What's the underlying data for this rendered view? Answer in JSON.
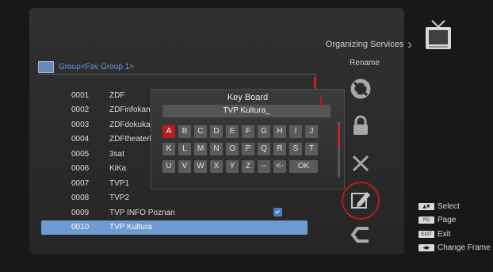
{
  "group": {
    "label": "Group<Fav Group 1>"
  },
  "channels": [
    {
      "num": "0001",
      "name": "ZDF"
    },
    {
      "num": "0002",
      "name": "ZDFinfokanal"
    },
    {
      "num": "0003",
      "name": "ZDFdokukanal"
    },
    {
      "num": "0004",
      "name": "ZDFtheaterkan"
    },
    {
      "num": "0005",
      "name": "3sat"
    },
    {
      "num": "0006",
      "name": "KiKa"
    },
    {
      "num": "0007",
      "name": "TVP1"
    },
    {
      "num": "0008",
      "name": "TVP2"
    },
    {
      "num": "0009",
      "name": "TVP INFO Poznan"
    },
    {
      "num": "0010",
      "name": "TVP Kultura"
    }
  ],
  "keyboard": {
    "title": "Key Board",
    "input_value": "TVP Kultura_",
    "row1": [
      "A",
      "B",
      "C",
      "D",
      "E",
      "F",
      "G",
      "H",
      "I",
      "J"
    ],
    "row2": [
      "K",
      "L",
      "M",
      "N",
      "O",
      "P",
      "Q",
      "R",
      "S",
      "T"
    ],
    "row3": [
      "U",
      "V",
      "W",
      "X",
      "Y",
      "Z",
      "--",
      "<-",
      "OK"
    ]
  },
  "menu": {
    "title": "Organizing Services",
    "subtitle": "Rename"
  },
  "legend": [
    {
      "key": "▲▼",
      "label": "Select"
    },
    {
      "key": "PG",
      "label": "Page"
    },
    {
      "key": "EXIT",
      "label": "Exit"
    },
    {
      "key": "◀▶",
      "label": "Change Frame"
    }
  ],
  "colors": {
    "accent_red": "#b31f1f",
    "selection_blue": "#6e9ad1",
    "group_blue": "#5f95d8"
  }
}
